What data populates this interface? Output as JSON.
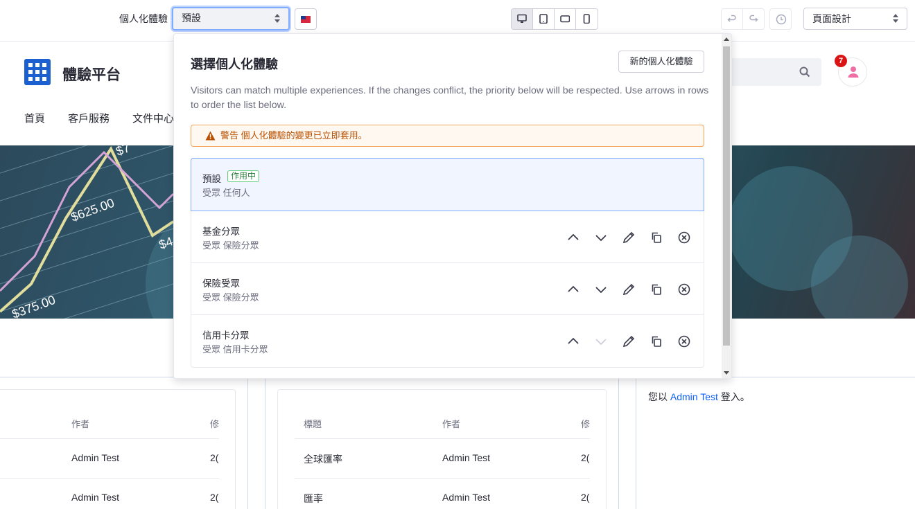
{
  "topbar": {
    "experience_label": "個人化體驗",
    "experience_selected": "預設",
    "flag_icon": "taiwan-flag-icon",
    "layout_selected": "頁面設計"
  },
  "site": {
    "name": "體驗平台",
    "notifications": "7",
    "nav": [
      "首頁",
      "客戶服務",
      "文件中心"
    ]
  },
  "hero": {
    "labels": [
      "$625.00",
      "$375.00",
      "$4",
      "$7"
    ]
  },
  "panel": {
    "title": "選擇個人化體驗",
    "new_button": "新的個人化體驗",
    "description": "Visitors can match multiple experiences. If the changes conflict, the priority below will be respected. Use arrows in rows to order the list below.",
    "warning_strong": "警告",
    "warning_text": "個人化體驗的變更已立即套用。",
    "items": [
      {
        "name": "預設",
        "badge": "作用中",
        "segment": "受眾 任何人"
      },
      {
        "name": "基金分眾",
        "segment": "受眾 保險分眾"
      },
      {
        "name": "保險受眾",
        "segment": "受眾 保險分眾"
      },
      {
        "name": "信用卡分眾",
        "segment": "受眾 信用卡分眾"
      }
    ]
  },
  "tables": {
    "left": {
      "headers": [
        "作者",
        "修"
      ],
      "rows": [
        [
          "Admin Test",
          "2("
        ],
        [
          "Admin Test",
          "2("
        ]
      ]
    },
    "middle": {
      "headers": [
        "標題",
        "作者",
        "修"
      ],
      "rows": [
        [
          "全球匯率",
          "Admin Test",
          "2("
        ],
        [
          "匯率",
          "Admin Test",
          "2("
        ]
      ]
    }
  },
  "signed_in": {
    "prefix": "您以",
    "user": "Admin Test",
    "suffix": "登入。"
  },
  "colors": {
    "accent": "#0b5fff",
    "warning": "#b95000",
    "success": "#287d3c",
    "logo": "#1c5fd0"
  }
}
